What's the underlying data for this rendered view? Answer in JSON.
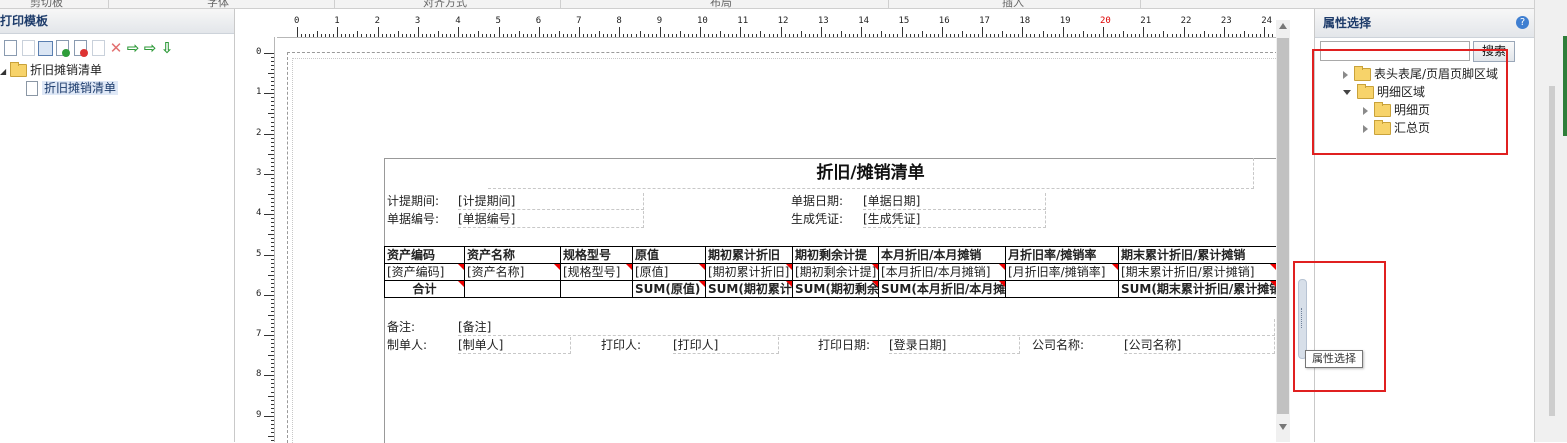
{
  "menu": {
    "items": [
      "剪切板",
      "字体",
      "对齐方式",
      "布局",
      "插入"
    ]
  },
  "left_panel": {
    "title": "打印模板",
    "tree": {
      "folder": "折旧摊销清单",
      "item": "折旧摊销清单"
    }
  },
  "ruler": {
    "h_numbers": [
      "0",
      "1",
      "2",
      "3",
      "4",
      "5",
      "6",
      "7",
      "8",
      "9",
      "10",
      "11",
      "12",
      "13",
      "14",
      "15",
      "16",
      "17",
      "18",
      "19",
      "20",
      "21",
      "22",
      "23",
      "24"
    ],
    "v_numbers": [
      "0",
      "1",
      "2",
      "3",
      "4",
      "5",
      "6",
      "7",
      "8",
      "9"
    ]
  },
  "report": {
    "title": "折旧/摊销清单",
    "header": {
      "period_label": "计提期间:",
      "period_value": "[计提期间]",
      "date_label": "单据日期:",
      "date_value": "[单据日期]",
      "number_label": "单据编号:",
      "number_value": "[单据编号]",
      "voucher_label": "生成凭证:",
      "voucher_value": "[生成凭证]"
    },
    "table": {
      "columns": [
        "资产编码",
        "资产名称",
        "规格型号",
        "原值",
        "期初累计折旧",
        "期初剩余计提",
        "本月折旧/本月摊销",
        "月折旧率/摊销率",
        "期末累计折旧/累计摊销"
      ],
      "row": [
        "[资产编码]",
        "[资产名称]",
        "[规格型号]",
        "[原值]",
        "[期初累计折旧]",
        "[期初剩余计提]",
        "[本月折旧/本月摊销]",
        "[月折旧率/摊销率]",
        "[期末累计折旧/累计摊销]"
      ],
      "total": [
        "合计",
        "",
        "",
        "SUM(原值)",
        "SUM(期初累计折旧)",
        "SUM(期初剩余计提)",
        "SUM(本月折旧/本月摊销)",
        "",
        "SUM(期末累计折旧/累计摊销)"
      ]
    },
    "footer": {
      "remark_label": "备注:",
      "remark_value": "[备注]",
      "maker_label": "制单人:",
      "maker_value": "[制单人]",
      "printer_label": "打印人:",
      "printer_value": "[打印人]",
      "print_date_label": "打印日期:",
      "print_date_value": "[登录日期]",
      "company_label": "公司名称:",
      "company_value": "[公司名称]"
    }
  },
  "right_panel": {
    "title": "属性选择",
    "help": "?",
    "search_button": "搜索",
    "tree": {
      "header_footer": "表头表尾/页眉页脚区域",
      "detail_area": "明细区域",
      "detail_page": "明细页",
      "summary_page": "汇总页"
    }
  },
  "tooltip": "属性选择",
  "colors": {
    "annotation": "#e02020",
    "accent": "#3f7fd1"
  }
}
